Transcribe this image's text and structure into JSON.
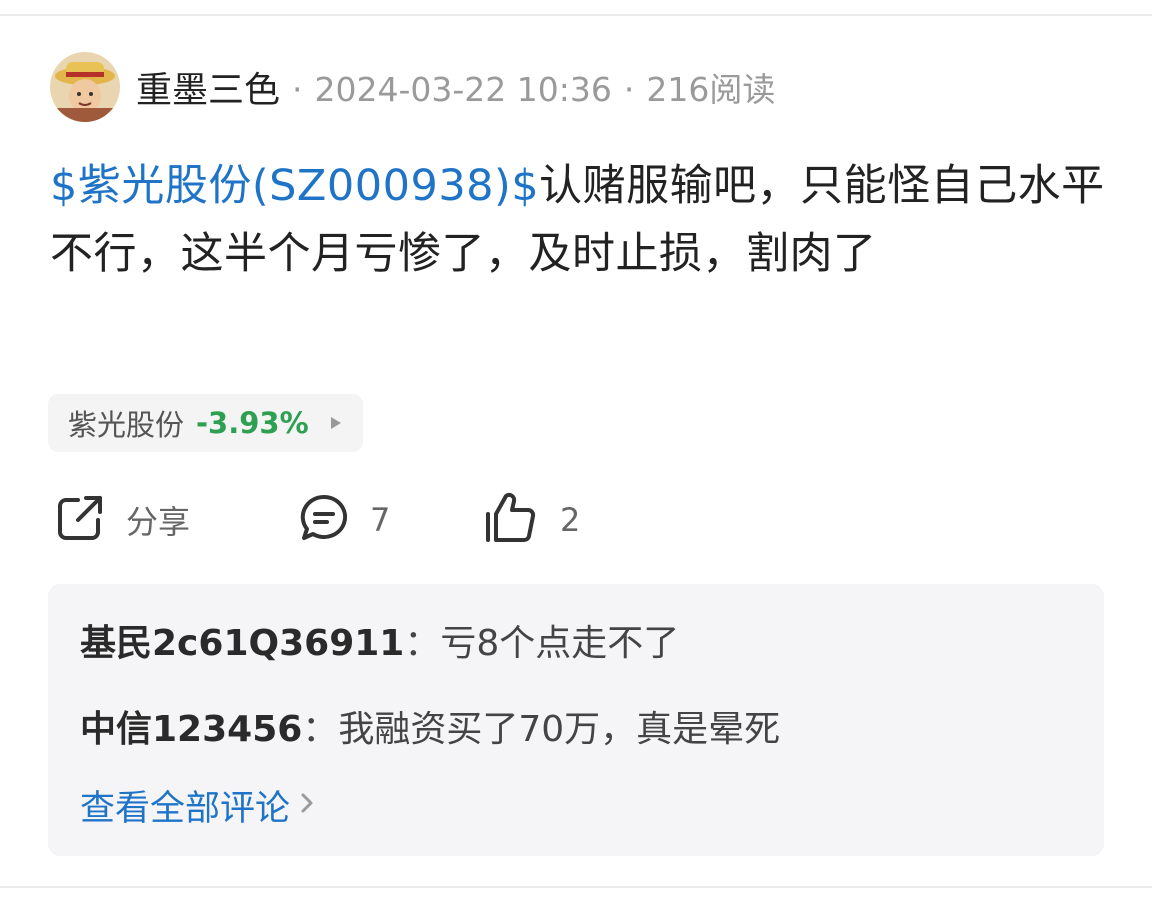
{
  "post": {
    "author": "重墨三色",
    "separator": "·",
    "timestamp": "2024-03-22 10:36",
    "views": "216阅读",
    "stock_tag": "$紫光股份(SZ000938)$",
    "content": "认赌服输吧，只能怪自己水平不行，这半个月亏惨了，及时止损，割肉了"
  },
  "stock_chip": {
    "name": "紫光股份",
    "change": "-3.93%",
    "change_color": "#2ea052"
  },
  "actions": {
    "share_label": "分享",
    "comment_count": "7",
    "like_count": "2"
  },
  "comments": [
    {
      "user": "基民2c61Q36911",
      "colon": "：",
      "text": "亏8个点走不了"
    },
    {
      "user": "中信123456",
      "colon": "：",
      "text": "我融资买了70万，真是晕死"
    }
  ],
  "view_all_comments": "查看全部评论",
  "icons": {
    "share": "share-icon",
    "comment": "comment-icon",
    "like": "thumbs-up-icon",
    "chip_arrow": "play-arrow-icon",
    "chevron": "chevron-right-icon"
  },
  "colors": {
    "link_blue": "#1f74c8",
    "down_green": "#2ea052",
    "meta_gray": "#9a9a9a"
  }
}
